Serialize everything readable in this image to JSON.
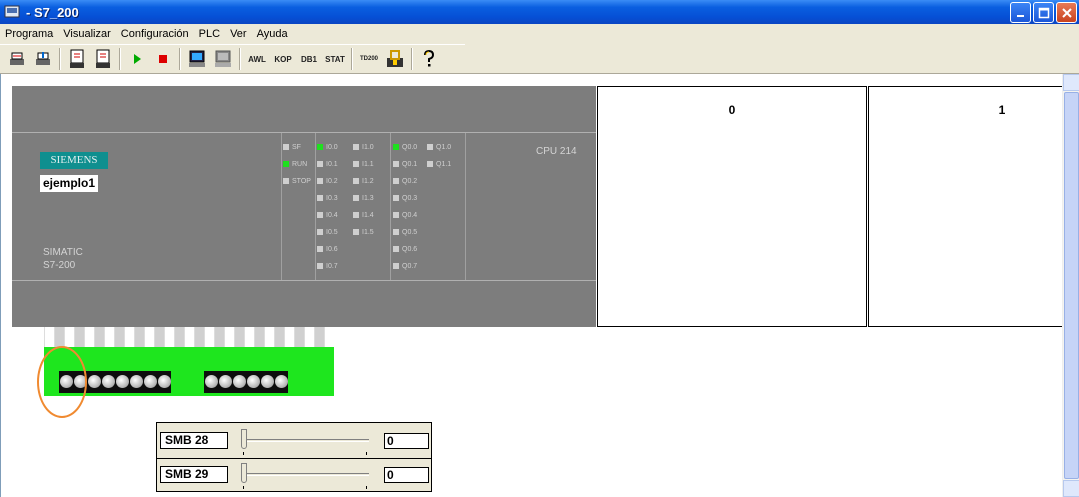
{
  "window": {
    "title": "- S7_200"
  },
  "menu": [
    "Programa",
    "Visualizar",
    "Configuración",
    "PLC",
    "Ver",
    "Ayuda"
  ],
  "toolbar": {
    "text_buttons": [
      "AWL",
      "KOP",
      "DB1",
      "STAT",
      "TD200"
    ]
  },
  "cpu": {
    "brand": "SIEMENS",
    "project": "ejemplo1",
    "family_line1": "SIMATIC",
    "family_line2": "S7-200",
    "model": "CPU 214",
    "status_leds": [
      {
        "label": "SF",
        "on": false
      },
      {
        "label": "RUN",
        "on": true
      },
      {
        "label": "STOP",
        "on": false
      }
    ],
    "inputs_col1": [
      {
        "label": "I0.0",
        "on": true
      },
      {
        "label": "I0.1",
        "on": false
      },
      {
        "label": "I0.2",
        "on": false
      },
      {
        "label": "I0.3",
        "on": false
      },
      {
        "label": "I0.4",
        "on": false
      },
      {
        "label": "I0.5",
        "on": false
      },
      {
        "label": "I0.6",
        "on": false
      },
      {
        "label": "I0.7",
        "on": false
      }
    ],
    "inputs_col2": [
      {
        "label": "I1.0",
        "on": false
      },
      {
        "label": "I1.1",
        "on": false
      },
      {
        "label": "I1.2",
        "on": false
      },
      {
        "label": "I1.3",
        "on": false
      },
      {
        "label": "I1.4",
        "on": false
      },
      {
        "label": "I1.5",
        "on": false
      }
    ],
    "outputs_col1": [
      {
        "label": "Q0.0",
        "on": true
      },
      {
        "label": "Q0.1",
        "on": false
      },
      {
        "label": "Q0.2",
        "on": false
      },
      {
        "label": "Q0.3",
        "on": false
      },
      {
        "label": "Q0.4",
        "on": false
      },
      {
        "label": "Q0.5",
        "on": false
      },
      {
        "label": "Q0.6",
        "on": false
      },
      {
        "label": "Q0.7",
        "on": false
      }
    ],
    "outputs_col2": [
      {
        "label": "Q1.0",
        "on": false
      },
      {
        "label": "Q1.1",
        "on": false
      }
    ]
  },
  "modules": [
    {
      "number": "0"
    },
    {
      "number": "1"
    }
  ],
  "smb": [
    {
      "label": "SMB 28",
      "value": "0"
    },
    {
      "label": "SMB 29",
      "value": "0"
    }
  ],
  "colors": {
    "cpu_body": "#7d7d7d",
    "led_on": "#1fe01f",
    "terminal": "#1ee61e",
    "siemens_badge": "#0f8f8f",
    "highlight": "#f08a30"
  }
}
